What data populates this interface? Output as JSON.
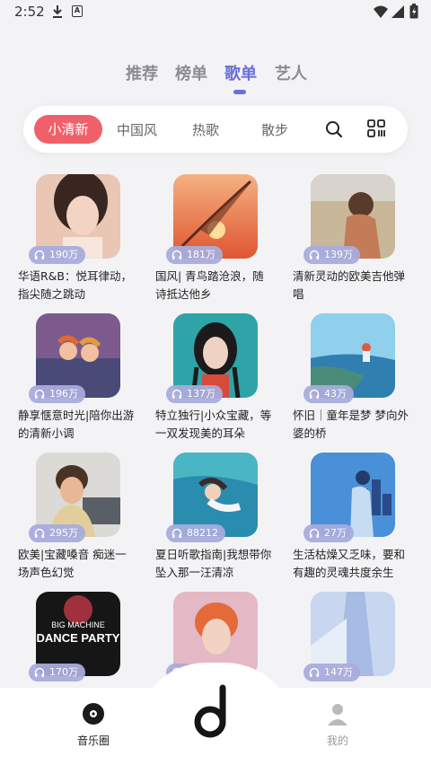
{
  "status_bar": {
    "time": "2:52",
    "a_letter": "A"
  },
  "top_tabs": [
    {
      "label": "推荐",
      "active": false
    },
    {
      "label": "榜单",
      "active": false
    },
    {
      "label": "歌单",
      "active": true
    },
    {
      "label": "艺人",
      "active": false
    }
  ],
  "categories": [
    {
      "label": "小清新",
      "active": true
    },
    {
      "label": "中国风",
      "active": false
    },
    {
      "label": "热歌",
      "active": false
    },
    {
      "label": "散步",
      "active": false
    }
  ],
  "playlists": [
    {
      "plays": "190万",
      "title": "华语R&B：悦耳律动，指尖随之跳动"
    },
    {
      "plays": "181万",
      "title": "国风| 青鸟踏沧浪，随诗抵达他乡"
    },
    {
      "plays": "139万",
      "title": "清新灵动的欧美吉他弹唱"
    },
    {
      "plays": "196万",
      "title": "静享惬意时光|陪你出游的清新小调"
    },
    {
      "plays": "137万",
      "title": "特立独行|小众宝藏，等一双发现美的耳朵"
    },
    {
      "plays": "43万",
      "title": "怀旧｜童年是梦 梦向外婆的桥"
    },
    {
      "plays": "295万",
      "title": "欧美|宝藏嗓音 痴迷一场声色幻觉"
    },
    {
      "plays": "88212",
      "title": "夏日听歌指南|我想带你坠入那一汪清凉"
    },
    {
      "plays": "27万",
      "title": "生活枯燥又乏味，要和有趣的灵魂共度余生"
    },
    {
      "plays": "170万",
      "title": "",
      "cover_text_1": "BIG MACHINE",
      "cover_text_2": "DANCE PARTY"
    },
    {
      "plays": "",
      "title": ""
    },
    {
      "plays": "147万",
      "title": ""
    }
  ],
  "bottom_nav": {
    "left_label": "音乐圈",
    "right_label": "我的"
  },
  "colors": {
    "accent": "#6b6fd8",
    "category_active": "#f0606a"
  }
}
